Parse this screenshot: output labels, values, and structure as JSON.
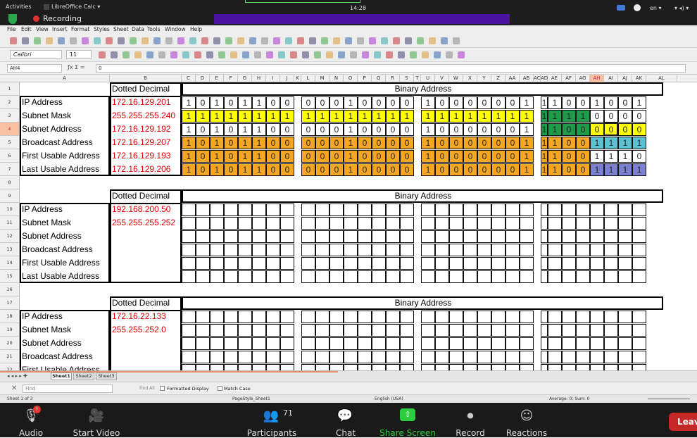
{
  "system": {
    "activities": "Activities",
    "app": "LibreOffice Calc ▾",
    "clock": "14:28",
    "lang": "en ▾",
    "recording": "Recording"
  },
  "menu": [
    "File",
    "Edit",
    "View",
    "Insert",
    "Format",
    "Styles",
    "Sheet",
    "Data",
    "Tools",
    "Window",
    "Help"
  ],
  "format": {
    "font": "Calibri",
    "size": "11"
  },
  "formula": {
    "namebox": "AH4",
    "content": "0"
  },
  "columns": [
    "A",
    "B",
    "C",
    "D",
    "E",
    "F",
    "G",
    "H",
    "I",
    "J",
    "K",
    "L",
    "M",
    "N",
    "O",
    "P",
    "Q",
    "R",
    "S",
    "T",
    "U",
    "V",
    "W",
    "X",
    "Y",
    "Z",
    "AA",
    "AB",
    "AC",
    "AD",
    "AE",
    "AF",
    "AG",
    "AH",
    "AI",
    "AJ",
    "AK",
    "AL"
  ],
  "rows": [
    "1",
    "2",
    "3",
    "4",
    "5",
    "6",
    "7",
    "8",
    "9",
    "10",
    "11",
    "12",
    "13",
    "14",
    "15",
    "16",
    "17",
    "18",
    "19",
    "20",
    "21",
    "22"
  ],
  "tables": [
    {
      "header_dotted": "Dotted Decimal",
      "header_binary": "Binary Address",
      "rows": [
        {
          "label": "IP Address",
          "value": "172.16.129.201",
          "bits": "10101100000100001000000111001001",
          "fill": "wwwwwwwwwwwwwwwwwwwwwwwwwwwwwwww"
        },
        {
          "label": "Subnet Mask",
          "value": "255.255.255.240",
          "bits": "11111111111111111111111111110000",
          "fill": "yyyyyyyyyyyyyyyyyyyyyyyyggggwwww"
        },
        {
          "label": "Subnet Address",
          "value": "172.16.129.192",
          "bits": "10101100000100001000000111000000",
          "fill": "wwwwwwwwwwwwwwwwwwwwwwwwggggyyyy"
        },
        {
          "label": "Broadcast Address",
          "value": "172.16.129.207",
          "bits": "10101100000100001000000111001111",
          "fill": "ooooooooooooooooooooooooooootttt"
        },
        {
          "label": "First Usable Address",
          "value": "172.16.129.193",
          "bits": "10101100000100001000000111001110",
          "fill": "oooooooooooooooooooooooooooowwww"
        },
        {
          "label": "Last Usable Address",
          "value": "172.16.129.206",
          "bits": "10101100000100001000000111001111",
          "fill": "ooooooooooooooooooooooooooooppp p"
        }
      ]
    },
    {
      "header_dotted": "Dotted Decimal",
      "header_binary": "Binary Address",
      "rows": [
        {
          "label": "IP Address",
          "value": "192.168.200.50",
          "bits": "",
          "fill": ""
        },
        {
          "label": "Subnet Mask",
          "value": "255.255.255.252",
          "bits": "",
          "fill": ""
        },
        {
          "label": "Subnet Address",
          "value": "",
          "bits": "",
          "fill": ""
        },
        {
          "label": "Broadcast Address",
          "value": "",
          "bits": "",
          "fill": ""
        },
        {
          "label": "First Usable Address",
          "value": "",
          "bits": "",
          "fill": ""
        },
        {
          "label": "Last Usable Address",
          "value": "",
          "bits": "",
          "fill": ""
        }
      ]
    },
    {
      "header_dotted": "Dotted Decimal",
      "header_binary": "Binary Address",
      "rows": [
        {
          "label": "IP Address",
          "value": "172.16.22.133",
          "bits": "",
          "fill": ""
        },
        {
          "label": "Subnet Mask",
          "value": "255.255.252.0",
          "bits": "",
          "fill": ""
        },
        {
          "label": "Subnet Address",
          "value": "",
          "bits": "",
          "fill": ""
        },
        {
          "label": "Broadcast Address",
          "value": "",
          "bits": "",
          "fill": ""
        },
        {
          "label": "First Usable Address",
          "value": "",
          "bits": "",
          "fill": ""
        }
      ]
    }
  ],
  "tabs": [
    "Sheet1",
    "Sheet2",
    "Sheet3"
  ],
  "find": {
    "placeholder": "Find",
    "find_all": "Find All",
    "formatted": "Formatted Display",
    "match_case": "Match Case"
  },
  "status": {
    "sheet": "Sheet 1 of 3",
    "style": "PageStyle_Sheet1",
    "lang": "English (USA)",
    "sum": "Average: 0; Sum: 0"
  },
  "zoom": {
    "audio": "Audio",
    "video": "Start Video",
    "participants": "Participants",
    "count": "71",
    "chat": "Chat",
    "share": "Share Screen",
    "record": "Record",
    "reactions": "Reactions",
    "leave": "Leave"
  },
  "colors": {
    "yellow": "#ffff00",
    "green": "#1e9a4a",
    "orange": "#f5a623",
    "teal": "#5bc0cf",
    "purple": "#7b7fd0",
    "share": "#2ecc40"
  }
}
